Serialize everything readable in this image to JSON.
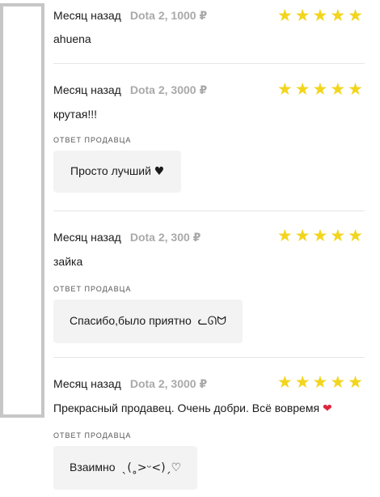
{
  "reviews": [
    {
      "date": "Месяц назад",
      "product": "Dota 2, 1000 ₽",
      "rating": 5,
      "text": "ahuena",
      "text_suffix": "",
      "seller_reply": null
    },
    {
      "date": "Месяц назад",
      "product": "Dota 2, 3000 ₽",
      "rating": 5,
      "text": "крутая!!!",
      "text_suffix": "",
      "seller_reply": {
        "label": "Ответ продавца",
        "text": "Просто лучший",
        "symbol": "♥"
      }
    },
    {
      "date": "Месяц назад",
      "product": "Dota 2, 300 ₽",
      "rating": 5,
      "text": "зайка",
      "text_suffix": "",
      "seller_reply": {
        "label": "Ответ продавца",
        "text": "Спасибо,было приятно",
        "symbol": "ᓚᘏᗢ"
      }
    },
    {
      "date": "Месяц назад",
      "product": "Dota 2, 3000 ₽",
      "rating": 5,
      "text": "Прекрасный продавец. Очень добри. Всё вовремя",
      "text_suffix": "❤",
      "seller_reply": {
        "label": "Ответ продавца",
        "text": "Взаимно",
        "symbol": "ˎ(˳>ᵕ<)ˏ♡"
      }
    }
  ],
  "colors": {
    "star": "#f2d51d",
    "muted": "#a9a9a9",
    "reply_bg": "#f3f3f3",
    "heart": "#e0243c"
  }
}
